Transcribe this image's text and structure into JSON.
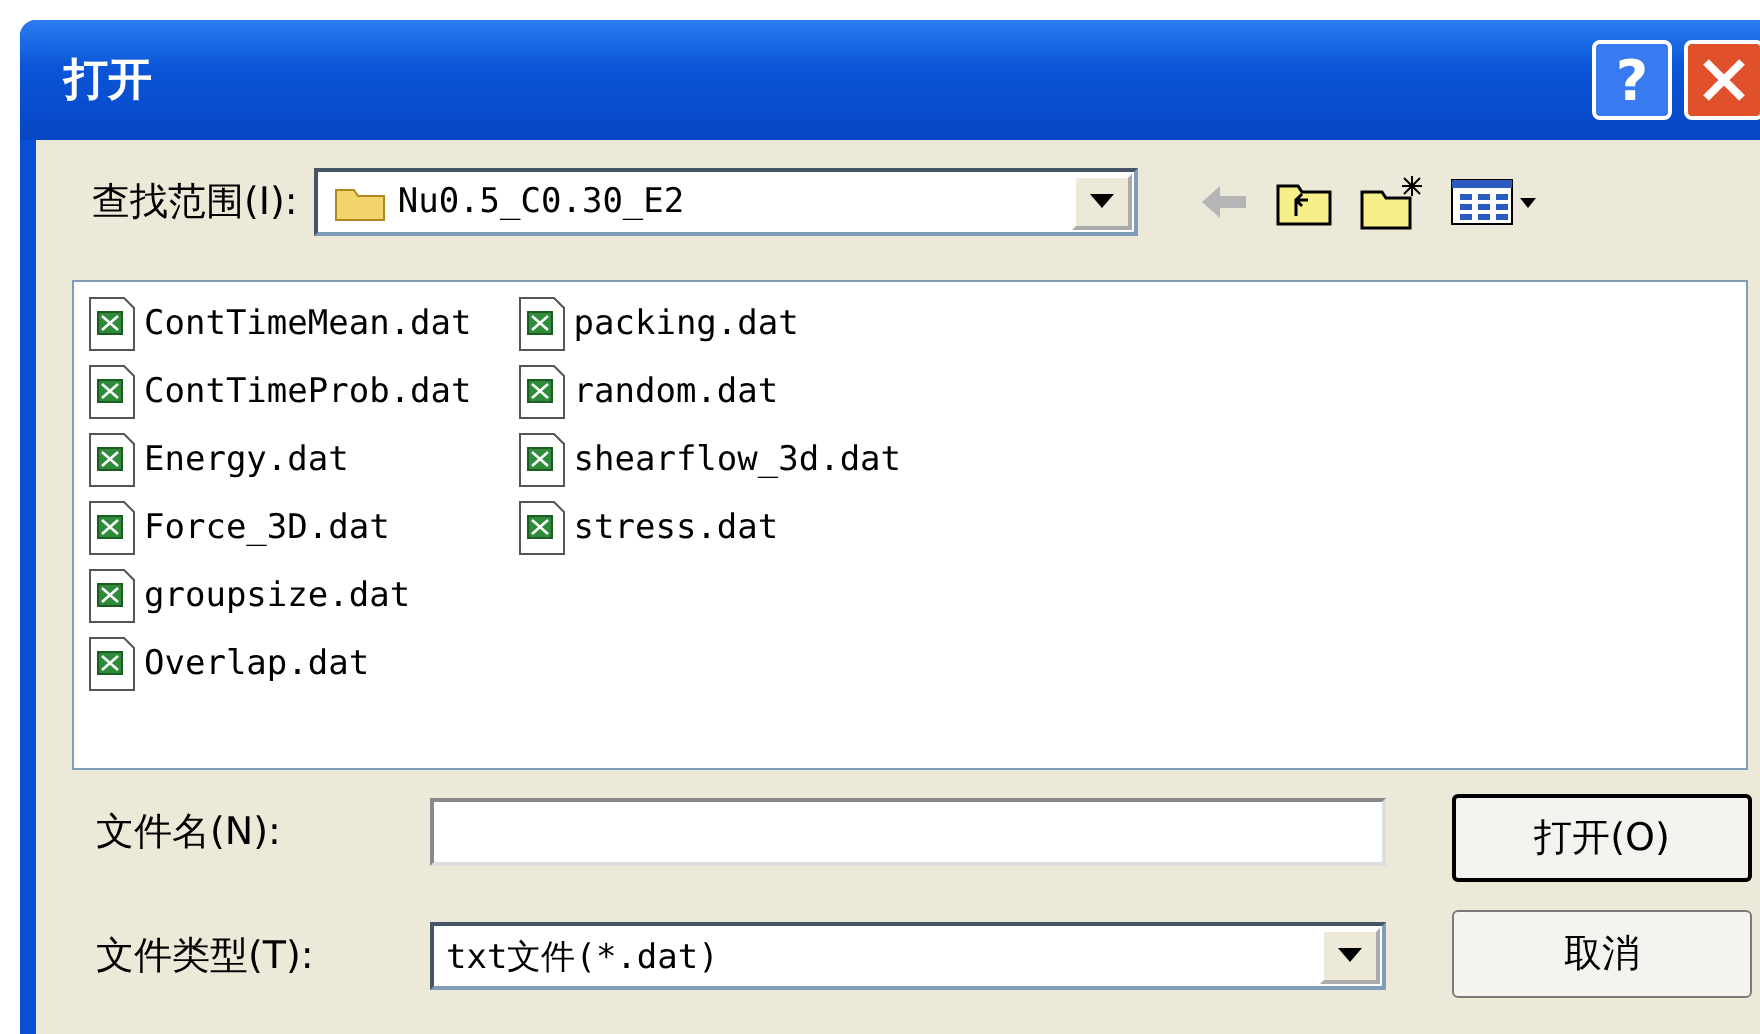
{
  "window": {
    "title": "打开",
    "help_button": "?"
  },
  "look_in": {
    "label": "查找范围(I):",
    "value": "Nu0.5_C0.30_E2"
  },
  "toolbar": [
    {
      "kind": "back",
      "disabled": true
    },
    {
      "kind": "up",
      "disabled": false
    },
    {
      "kind": "new-folder",
      "disabled": false
    },
    {
      "kind": "view-menu",
      "disabled": false
    }
  ],
  "files": [
    {
      "name": "ContTimeMean.dat",
      "selected": false
    },
    {
      "name": "ContTimeProb.dat",
      "selected": false
    },
    {
      "name": "Energy.dat",
      "selected": false
    },
    {
      "name": "Force_3D.dat",
      "selected": false
    },
    {
      "name": "groupsize.dat",
      "selected": false
    },
    {
      "name": "Overlap.dat",
      "selected": false
    },
    {
      "name": "packing.dat",
      "selected": false
    },
    {
      "name": "random.dat",
      "selected": false
    },
    {
      "name": "shearflow_3d.dat",
      "selected": false
    },
    {
      "name": "stress.dat",
      "selected": false
    }
  ],
  "file_name": {
    "label": "文件名(N):"
  },
  "file_type": {
    "label": "文件类型(T):",
    "value": "txt文件(*.dat)"
  },
  "buttons": [
    {
      "label": "打开(O)",
      "default": true
    },
    {
      "label": "取消",
      "default": false
    }
  ]
}
